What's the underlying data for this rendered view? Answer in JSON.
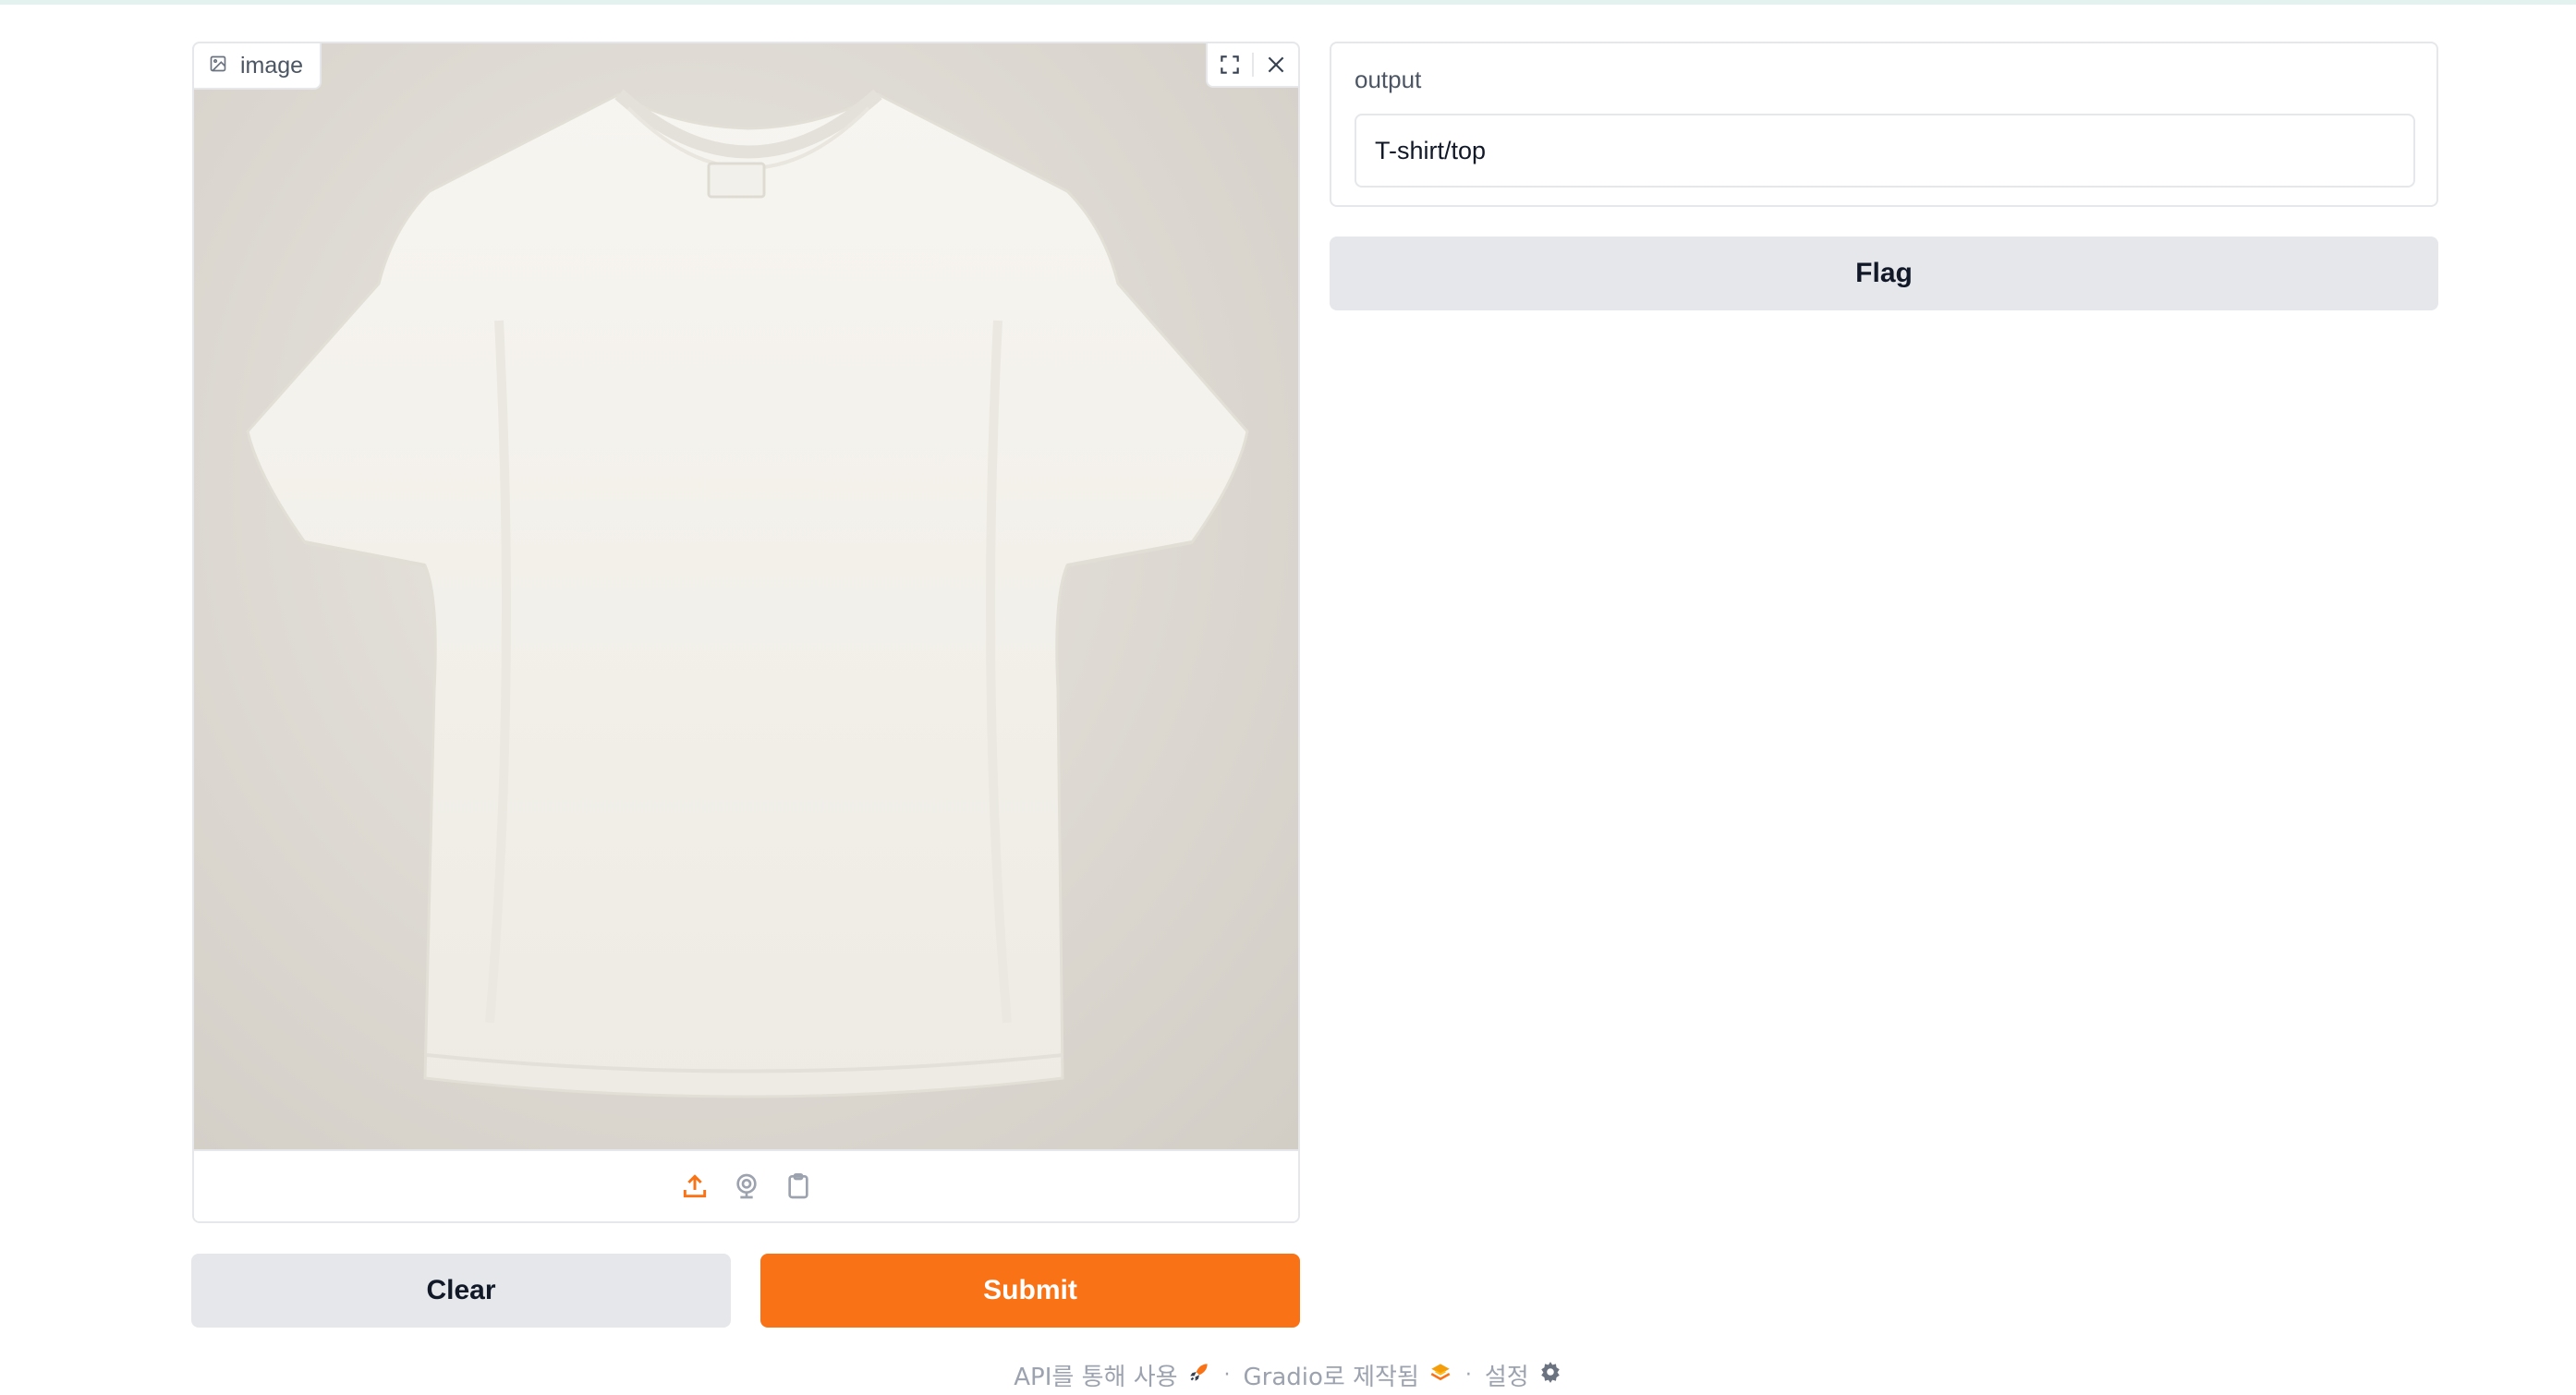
{
  "image_input": {
    "label": "image"
  },
  "output": {
    "label": "output",
    "value": "T-shirt/top"
  },
  "buttons": {
    "clear": "Clear",
    "submit": "Submit",
    "flag": "Flag"
  },
  "footer": {
    "api": "API를 통해 사용",
    "built_with": "Gradio로 제작됨",
    "settings": "설정",
    "separator": "·"
  },
  "icons": {
    "image_label": "image-icon",
    "fullscreen": "fullscreen-icon",
    "close": "close-icon",
    "upload": "upload-icon",
    "webcam": "webcam-icon",
    "clipboard": "clipboard-icon",
    "api": "rocket-icon",
    "gradio": "gradio-logo-icon",
    "settings": "gear-icon"
  },
  "colors": {
    "accent": "#f97316",
    "neutral_button": "#e5e7eb",
    "border": "#e5e7eb"
  }
}
